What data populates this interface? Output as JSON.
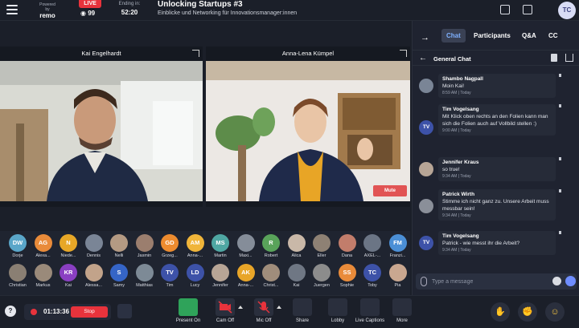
{
  "topbar": {
    "powered_by": "Powered by",
    "brand": "remo",
    "live": "LIVE",
    "viewers": "99",
    "ending_label": "Ending in:",
    "ending_time": "52:20",
    "title": "Unlocking Startups #3",
    "subtitle": "Einblicke und Networking für Innovationsmanager:innen",
    "user_initials": "TC"
  },
  "stage": {
    "speakers": [
      {
        "name": "Kai Engelhardt"
      },
      {
        "name": "Anna-Lena Kümpel"
      }
    ],
    "mute_label": "Mute"
  },
  "audience": [
    {
      "initials": "DW",
      "name": "Dorje",
      "color": "#5aa6c9"
    },
    {
      "initials": "AG",
      "name": "Alexa...",
      "color": "#e98b3a"
    },
    {
      "initials": "N",
      "name": "Niede...",
      "color": "#e7a727"
    },
    {
      "initials": "",
      "name": "Dennis",
      "color": "#7a8596"
    },
    {
      "initials": "",
      "name": "Nelli",
      "color": "#b49a83"
    },
    {
      "initials": "",
      "name": "Jasmin",
      "color": "#9b7e6e"
    },
    {
      "initials": "GD",
      "name": "Grzeg...",
      "color": "#ec8b2f"
    },
    {
      "initials": "AM",
      "name": "Anna-...",
      "color": "#f0b53a"
    },
    {
      "initials": "MS",
      "name": "Martin",
      "color": "#4fa7a3"
    },
    {
      "initials": "",
      "name": "Maxi...",
      "color": "#858d99"
    },
    {
      "initials": "R",
      "name": "Robert",
      "color": "#59a35a"
    },
    {
      "initials": "",
      "name": "Alica",
      "color": "#c9b8a8"
    },
    {
      "initials": "",
      "name": "Eller",
      "color": "#8e8174"
    },
    {
      "initials": "",
      "name": "Dana",
      "color": "#c27d6b"
    },
    {
      "initials": "",
      "name": "AXEL-...",
      "color": "#6b7585"
    },
    {
      "initials": "FM",
      "name": "Franzi...",
      "color": "#4b8fd6"
    },
    {
      "initials": "",
      "name": "Christian",
      "color": "#8a7f73"
    },
    {
      "initials": "",
      "name": "Markus",
      "color": "#9a8a7a"
    },
    {
      "initials": "KR",
      "name": "Kai",
      "color": "#8a3fc2"
    },
    {
      "initials": "",
      "name": "Alessa...",
      "color": "#c2a38a"
    },
    {
      "initials": "S",
      "name": "Samy",
      "color": "#3565c7"
    },
    {
      "initials": "",
      "name": "Matthias",
      "color": "#7d8a96"
    },
    {
      "initials": "TV",
      "name": "Tim",
      "color": "#3d52a8"
    },
    {
      "initials": "LD",
      "name": "Lucy",
      "color": "#3d52a8"
    },
    {
      "initials": "",
      "name": "Jennifer",
      "color": "#b7a596"
    },
    {
      "initials": "AK",
      "name": "Anna-...",
      "color": "#e8a528"
    },
    {
      "initials": "",
      "name": "Christ...",
      "color": "#a08d7b"
    },
    {
      "initials": "",
      "name": "Kai",
      "color": "#6f7784"
    },
    {
      "initials": "",
      "name": "Juergen",
      "color": "#8c8c8c"
    },
    {
      "initials": "SS",
      "name": "Sophie",
      "color": "#e98b3a"
    },
    {
      "initials": "TC",
      "name": "Toby",
      "color": "#3d52a8"
    },
    {
      "initials": "",
      "name": "Pia",
      "color": "#c9a790"
    }
  ],
  "panel": {
    "tabs": [
      "Chat",
      "Participants",
      "Q&A",
      "CC"
    ],
    "active_tab": "Chat",
    "chat_title": "General Chat",
    "messages": [
      {
        "sender": "Shambo Nagpall",
        "text": "Moin Kai!",
        "time": "8:59 AM | Today",
        "avatar": "",
        "color": "#7a8596"
      },
      {
        "sender": "Tim Vogelsang",
        "text": "Mit Klick oben rechts an den Folien kann man sich die Folien auch auf Vollbild stellen :)",
        "time": "9:00 AM | Today",
        "avatar": "TV",
        "color": "#3d52a8"
      },
      {
        "sender": "Jennifer Kraus",
        "text": "so true!",
        "time": "9:34 AM | Today",
        "avatar": "",
        "color": "#b7a596"
      },
      {
        "sender": "Patrick Wirth",
        "text": "Stimme ich nicht ganz zu. Unsere Arbeit muss messbar sein!",
        "time": "9:34 AM | Today",
        "avatar": "",
        "color": "#8a8f99"
      },
      {
        "sender": "Tim Vogelsang",
        "text": "Patrick - wie messt ihr die Arbeit?",
        "time": "9:34 AM | Today",
        "avatar": "TV",
        "color": "#3d52a8"
      }
    ],
    "input_placeholder": "Type a message"
  },
  "bottombar": {
    "help": "?",
    "rec_time": "01:13:36",
    "stop": "Stop",
    "controls": [
      "Present On",
      "Cam Off",
      "Mic Off",
      "Share",
      "Lobby",
      "Live Captions",
      "More"
    ]
  }
}
